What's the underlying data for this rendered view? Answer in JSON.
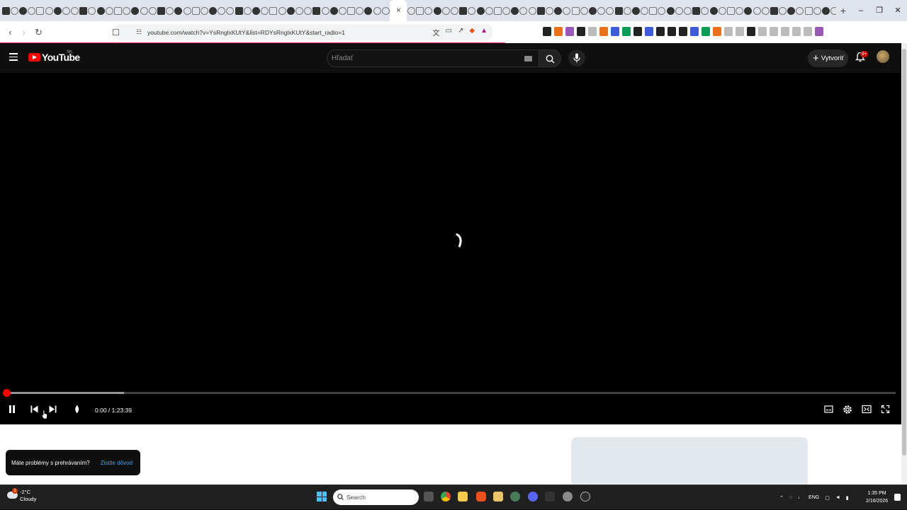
{
  "browser": {
    "url": "youtube.com/watch?v=YsRnglxKUtY&list=RDYsRnglxKUtY&start_radio=1",
    "active_tab_close": "×",
    "new_tab": "+",
    "window_controls": [
      "–",
      "❐",
      "✕"
    ]
  },
  "youtube": {
    "logo_text": "YouTube",
    "country_code": "SK",
    "search_placeholder": "Hľadať",
    "create_label": "Vytvoriť",
    "notification_badge": "9+"
  },
  "player": {
    "current_time": "0:00",
    "duration": "1:23:39",
    "time_display": "0:00 / 1:23:39",
    "played_fraction": 0.0,
    "buffered_fraction": 0.133,
    "state": "loading"
  },
  "toast": {
    "message": "Máte problémy s prehrávaním?",
    "link": "Zistite dôvod"
  },
  "taskbar": {
    "weather_temp": "-2°C",
    "weather_desc": "Cloudy",
    "weather_badge": "1",
    "search_label": "Search",
    "language": "ENG",
    "time": "1:35 PM",
    "date": "2/16/2026"
  },
  "colors": {
    "youtube_red": "#ff0000",
    "page_bg": "#0f0f0f",
    "link_blue": "#3ea6ff",
    "taskbar_bg": "#202020"
  }
}
